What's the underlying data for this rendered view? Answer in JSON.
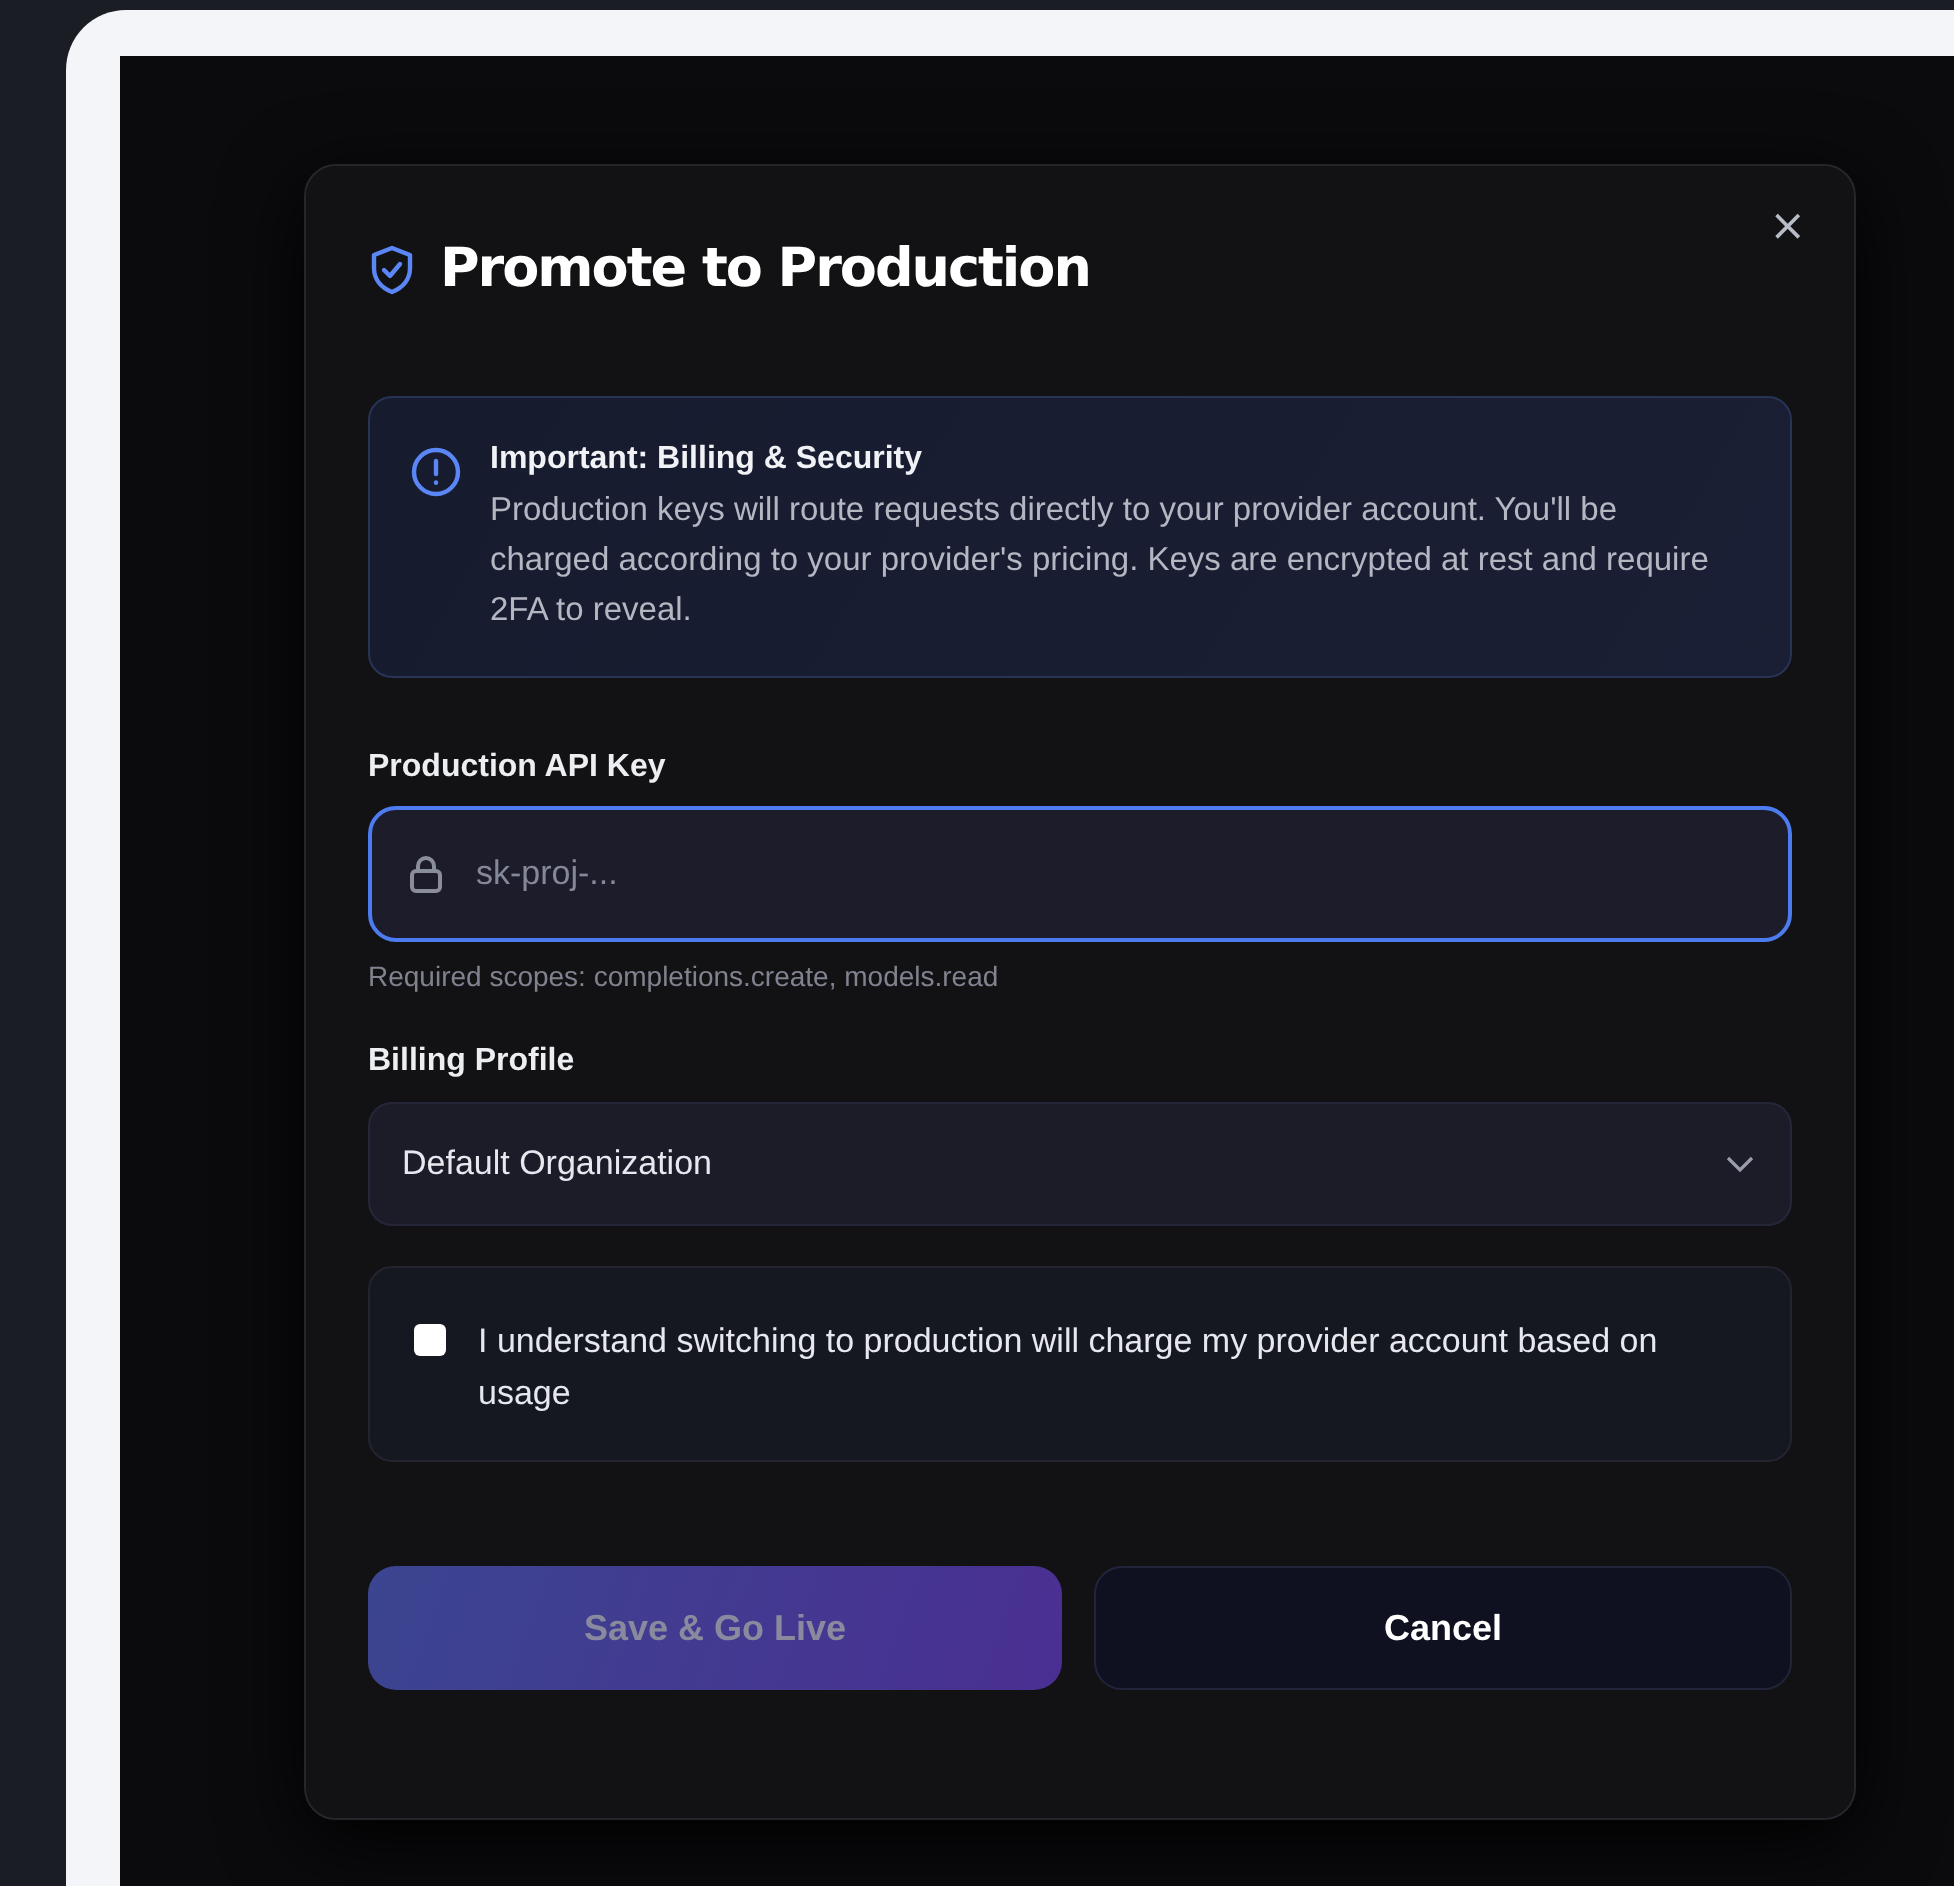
{
  "dialog": {
    "title": "Promote to Production",
    "close": "×",
    "notice": {
      "title": "Important: Billing & Security",
      "body": "Production keys will route requests directly to your provider account. You'll be charged according to your provider's pricing. Keys are encrypted at rest and require 2FA to reveal."
    },
    "api_key": {
      "label": "Production API Key",
      "placeholder": "sk-proj-...",
      "focused": true,
      "hint": "Required scopes: completions.create, models.read"
    },
    "billing": {
      "label": "Billing Profile",
      "value": "Default Organization"
    },
    "consent": {
      "label": "I understand switching to production will charge my provider account based on usage",
      "checked": false
    },
    "buttons": [
      {
        "kind": "primary",
        "label": "Save & Go Live",
        "disabled": true
      },
      {
        "kind": "secondary",
        "label": "Cancel",
        "disabled": false
      }
    ]
  }
}
